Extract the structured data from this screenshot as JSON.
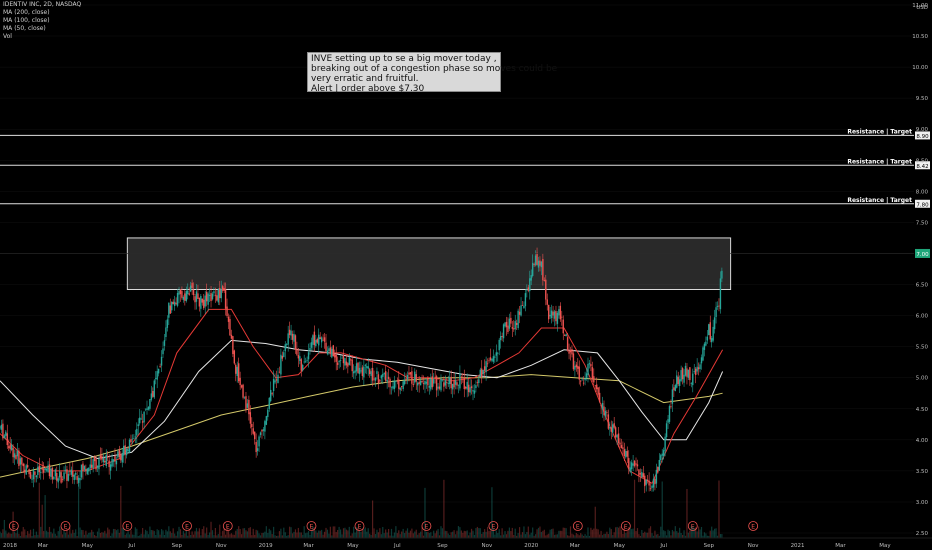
{
  "legend": {
    "title": "IDENTIV INC, 2D, NASDAQ",
    "ma200": "MA (200, close)",
    "ma100": "MA (100, close)",
    "ma50": "MA (50, close)",
    "vol": "Vol"
  },
  "note": {
    "line1": "INVE setting up to se a big mover today ,",
    "line2": "breaking out of a congestion phase so moves could be",
    "line3": "very erratic and fruitful.",
    "line4": "Alert | order above $7.30"
  },
  "colors": {
    "background": "#000000",
    "up": "#26a69a",
    "down": "#ef5350",
    "ma_red": "#e53935",
    "ma_white": "#e6e6e6",
    "ma_yellow": "#d4c96a",
    "label_green": "#1fa67a"
  },
  "chart_data": {
    "type": "candlestick",
    "y_axis": {
      "range": [
        2.42,
        11.08
      ],
      "ticks": [
        2.5,
        3.0,
        3.5,
        4.0,
        4.5,
        5.0,
        5.5,
        6.0,
        6.5,
        7.0,
        7.5,
        8.0,
        8.5,
        9.0,
        9.5,
        10.0,
        10.5,
        11.0
      ],
      "tick_labels": [
        "2.50",
        "3.00",
        "3.50",
        "4.00",
        "4.50",
        "5.00",
        "5.50",
        "6.00",
        "6.50",
        "7.00",
        "7.50",
        "8.00",
        "8.50",
        "9.00",
        "9.50",
        "10.00",
        "10.50",
        "11.00"
      ],
      "currency": "USD",
      "last_price_label": "7.00"
    },
    "x_axis": {
      "range": [
        "2018-01-01",
        "2021-06-10"
      ],
      "ticks": [
        {
          "date": "2018-01-01",
          "label": "2018"
        },
        {
          "date": "2018-03-01",
          "label": "Mar"
        },
        {
          "date": "2018-05-01",
          "label": "May"
        },
        {
          "date": "2018-07-01",
          "label": "Jul"
        },
        {
          "date": "2018-09-01",
          "label": "Sep"
        },
        {
          "date": "2018-11-01",
          "label": "Nov"
        },
        {
          "date": "2019-01-01",
          "label": "2019"
        },
        {
          "date": "2019-03-01",
          "label": "Mar"
        },
        {
          "date": "2019-05-01",
          "label": "May"
        },
        {
          "date": "2019-07-01",
          "label": "Jul"
        },
        {
          "date": "2019-09-01",
          "label": "Sep"
        },
        {
          "date": "2019-11-01",
          "label": "Nov"
        },
        {
          "date": "2020-01-01",
          "label": "2020"
        },
        {
          "date": "2020-03-01",
          "label": "Mar"
        },
        {
          "date": "2020-05-01",
          "label": "May"
        },
        {
          "date": "2020-07-01",
          "label": "Jul"
        },
        {
          "date": "2020-09-01",
          "label": "Sep"
        },
        {
          "date": "2020-11-01",
          "label": "Nov"
        },
        {
          "date": "2021-01-01",
          "label": "2021"
        },
        {
          "date": "2021-03-01",
          "label": "Mar"
        },
        {
          "date": "2021-05-01",
          "label": "May"
        }
      ]
    },
    "price_path": {
      "x": [
        "2018-01-01",
        "2018-01-20",
        "2018-02-10",
        "2018-03-05",
        "2018-03-25",
        "2018-04-15",
        "2018-05-05",
        "2018-05-25",
        "2018-06-10",
        "2018-06-25",
        "2018-07-10",
        "2018-07-25",
        "2018-08-10",
        "2018-08-20",
        "2018-09-05",
        "2018-09-20",
        "2018-10-05",
        "2018-10-20",
        "2018-11-05",
        "2018-11-20",
        "2018-12-05",
        "2018-12-20",
        "2019-01-05",
        "2019-01-20",
        "2019-02-05",
        "2019-02-20",
        "2019-03-05",
        "2019-03-20",
        "2019-04-10",
        "2019-05-01",
        "2019-05-20",
        "2019-06-10",
        "2019-07-01",
        "2019-07-20",
        "2019-08-10",
        "2019-08-25",
        "2019-09-10",
        "2019-09-25",
        "2019-10-10",
        "2019-10-25",
        "2019-11-10",
        "2019-11-25",
        "2019-12-10",
        "2019-12-20",
        "2020-01-05",
        "2020-01-15",
        "2020-01-25",
        "2020-02-10",
        "2020-02-25",
        "2020-03-10",
        "2020-03-20",
        "2020-04-01",
        "2020-04-15",
        "2020-05-01",
        "2020-05-15",
        "2020-06-01",
        "2020-06-15",
        "2020-07-01",
        "2020-07-15",
        "2020-08-01",
        "2020-08-10",
        "2020-08-20",
        "2020-09-01",
        "2020-09-05",
        "2020-09-10",
        "2020-09-15",
        "2020-09-20"
      ],
      "y": [
        4.2,
        3.8,
        3.45,
        3.5,
        3.4,
        3.45,
        3.6,
        3.65,
        3.7,
        3.9,
        4.2,
        4.6,
        5.2,
        6.1,
        6.3,
        6.4,
        6.2,
        6.3,
        6.35,
        5.2,
        4.6,
        3.8,
        4.6,
        5.2,
        5.8,
        5.1,
        5.6,
        5.6,
        5.3,
        5.2,
        5.1,
        5.0,
        4.9,
        5.0,
        5.0,
        4.9,
        4.9,
        5.0,
        4.8,
        5.1,
        5.3,
        5.8,
        5.9,
        6.1,
        6.9,
        6.8,
        6.0,
        6.0,
        5.3,
        4.9,
        5.2,
        4.8,
        4.3,
        4.0,
        3.6,
        3.4,
        3.2,
        3.9,
        4.9,
        5.1,
        5.0,
        5.2,
        5.8,
        5.6,
        6.0,
        6.2,
        6.95
      ]
    },
    "moving_averages": [
      {
        "name": "MA (200, close)",
        "x": [
          "2018-01-01",
          "2018-03-01",
          "2018-05-01",
          "2018-07-01",
          "2018-09-01",
          "2018-11-01",
          "2019-01-01",
          "2019-03-01",
          "2019-05-01",
          "2019-07-01",
          "2019-09-01",
          "2019-11-01",
          "2020-01-01",
          "2020-03-01",
          "2020-05-01",
          "2020-07-01",
          "2020-09-01",
          "2020-09-20"
        ],
        "y": [
          3.4,
          3.55,
          3.7,
          3.9,
          4.15,
          4.4,
          4.55,
          4.7,
          4.85,
          4.95,
          5.0,
          5.0,
          5.05,
          5.0,
          4.95,
          4.6,
          4.7,
          4.75
        ]
      },
      {
        "name": "MA (100, close)",
        "x": [
          "2018-01-01",
          "2018-02-15",
          "2018-04-01",
          "2018-05-15",
          "2018-07-01",
          "2018-08-15",
          "2018-10-01",
          "2018-11-15",
          "2019-01-01",
          "2019-02-15",
          "2019-04-01",
          "2019-05-15",
          "2019-07-01",
          "2019-08-15",
          "2019-10-01",
          "2019-11-15",
          "2020-01-01",
          "2020-02-15",
          "2020-04-01",
          "2020-05-01",
          "2020-06-01",
          "2020-07-01",
          "2020-08-01",
          "2020-09-01",
          "2020-09-20"
        ],
        "y": [
          4.95,
          4.4,
          3.9,
          3.7,
          3.8,
          4.3,
          5.1,
          5.6,
          5.55,
          5.45,
          5.4,
          5.3,
          5.25,
          5.15,
          5.05,
          5.0,
          5.2,
          5.45,
          5.4,
          4.95,
          4.45,
          4.0,
          4.0,
          4.6,
          5.1
        ]
      },
      {
        "name": "MA (50, close)",
        "x": [
          "2018-01-01",
          "2018-02-01",
          "2018-03-15",
          "2018-05-01",
          "2018-06-15",
          "2018-08-01",
          "2018-09-01",
          "2018-10-15",
          "2018-11-15",
          "2018-12-15",
          "2019-01-15",
          "2019-02-15",
          "2019-03-15",
          "2019-04-15",
          "2019-05-15",
          "2019-06-15",
          "2019-07-15",
          "2019-08-15",
          "2019-09-15",
          "2019-10-15",
          "2019-11-15",
          "2019-12-15",
          "2020-01-15",
          "2020-02-15",
          "2020-03-15",
          "2020-04-15",
          "2020-05-15",
          "2020-06-15",
          "2020-07-15",
          "2020-08-15",
          "2020-09-20"
        ],
        "y": [
          4.1,
          3.75,
          3.5,
          3.5,
          3.7,
          4.4,
          5.4,
          6.1,
          6.1,
          5.5,
          5.0,
          5.05,
          5.4,
          5.4,
          5.3,
          5.2,
          5.0,
          5.0,
          4.95,
          5.0,
          5.2,
          5.4,
          5.8,
          5.8,
          5.2,
          4.3,
          3.5,
          3.3,
          4.1,
          4.7,
          5.45
        ]
      }
    ],
    "resistance_lines": [
      {
        "label": "Resistance | Target",
        "value": 8.9
      },
      {
        "label": "Resistance | Target",
        "value": 8.42
      },
      {
        "label": "Resistance | Target",
        "value": 7.8
      }
    ],
    "resistance_value_labels": [
      "8.90",
      "8.42",
      "7.80"
    ],
    "congestion_box": {
      "x_start": "2018-06-25",
      "x_end": "2020-10-01",
      "y_low": 6.42,
      "y_high": 7.25
    },
    "earnings_markers": {
      "label": "E",
      "dates": [
        "2018-01-20",
        "2018-04-01",
        "2018-06-25",
        "2018-09-15",
        "2018-11-10",
        "2019-03-05",
        "2019-05-10",
        "2019-08-10",
        "2019-11-10",
        "2020-03-05",
        "2020-05-10",
        "2020-08-10",
        "2020-11-01"
      ]
    },
    "volume_note": "Volume bars along the bottom; largest spikes around 2020-01 and 2020-07 to 2020-09"
  }
}
